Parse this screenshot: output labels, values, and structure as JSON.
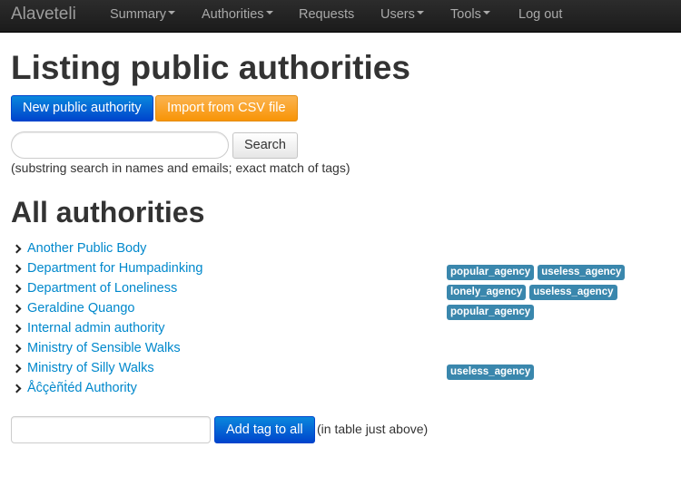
{
  "navbar": {
    "brand": "Alaveteli",
    "items": [
      {
        "label": "Summary",
        "dropdown": true
      },
      {
        "label": "Authorities",
        "dropdown": true
      },
      {
        "label": "Requests",
        "dropdown": false
      },
      {
        "label": "Users",
        "dropdown": true
      },
      {
        "label": "Tools",
        "dropdown": true
      },
      {
        "label": "Log out",
        "dropdown": false
      }
    ]
  },
  "page_title": "Listing public authorities",
  "actions": {
    "new_label": "New public authority",
    "import_label": "Import from CSV file"
  },
  "search": {
    "value": "",
    "placeholder": "",
    "button_label": "Search",
    "hint": "(substring search in names and emails; exact match of tags)"
  },
  "section_title": "All authorities",
  "authorities": [
    {
      "name": "Another Public Body",
      "tags": []
    },
    {
      "name": "Department for Humpadinking",
      "tags": [
        "popular_agency",
        "useless_agency"
      ]
    },
    {
      "name": "Department of Loneliness",
      "tags": [
        "lonely_agency",
        "useless_agency"
      ]
    },
    {
      "name": "Geraldine Quango",
      "tags": [
        "popular_agency"
      ]
    },
    {
      "name": "Internal admin authority",
      "tags": []
    },
    {
      "name": "Ministry of Sensible Walks",
      "tags": []
    },
    {
      "name": "Ministry of Silly Walks",
      "tags": [
        "useless_agency"
      ]
    },
    {
      "name": "Åĉçèñṫéd Authority",
      "tags": []
    }
  ],
  "tag_all": {
    "value": "",
    "button_label": "Add tag to all",
    "hint": "(in table just above)"
  },
  "colors": {
    "navbar": "#1b1b1b",
    "link": "#0088cc",
    "primary": "#0044cc",
    "warning": "#f89406",
    "tag": "#3a87ad"
  }
}
